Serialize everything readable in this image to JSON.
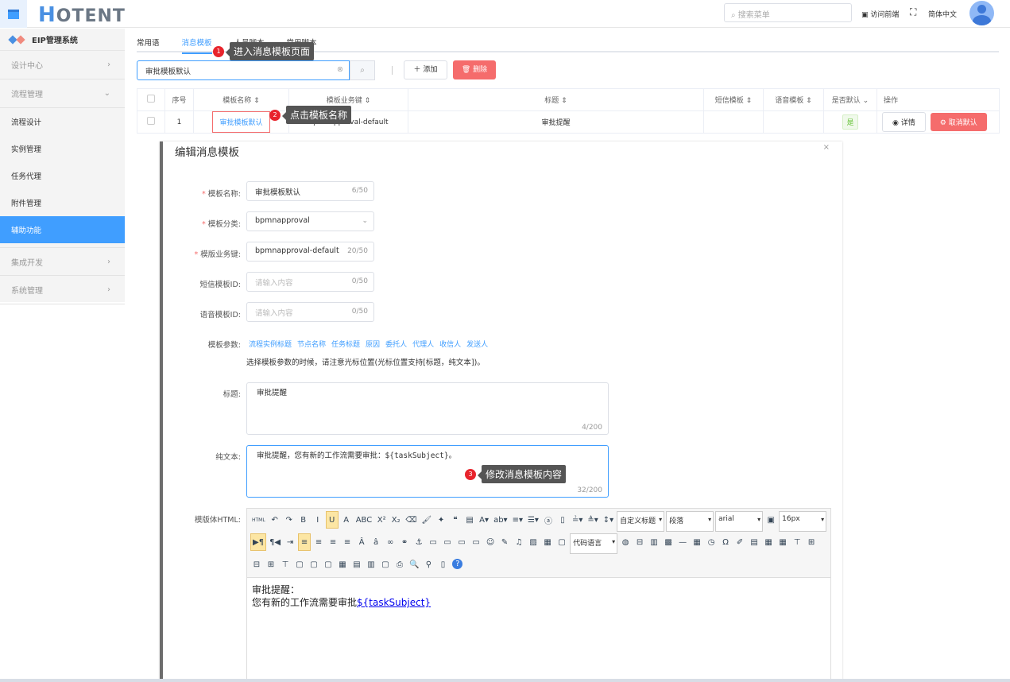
{
  "header": {
    "logo_text": "HOTENT",
    "search_placeholder": "搜索菜单",
    "visit_front": "访问前端",
    "language": "简体中文"
  },
  "sidebar": {
    "brand": "EIP管理系统",
    "groups": [
      {
        "label": "设计中心"
      },
      {
        "label": "流程管理"
      }
    ],
    "items": [
      {
        "label": "流程设计"
      },
      {
        "label": "实例管理"
      },
      {
        "label": "任务代理"
      },
      {
        "label": "附件管理"
      },
      {
        "label": "辅助功能"
      }
    ],
    "groups2": [
      {
        "label": "集成开发"
      },
      {
        "label": "系统管理"
      }
    ]
  },
  "tabs": [
    {
      "label": "常用语"
    },
    {
      "label": "消息模板"
    },
    {
      "label": "人员脚本"
    },
    {
      "label": "常用脚本"
    }
  ],
  "toolbar": {
    "search_value": "审批模板默认",
    "add_label": "添加",
    "delete_label": "删除"
  },
  "table": {
    "headers": [
      "序号",
      "模板名称",
      "模板业务键",
      "标题",
      "短信模板",
      "语音模板",
      "是否默认",
      "操作"
    ],
    "rows": [
      {
        "index": "1",
        "name": "审批模板默认",
        "key": "bpmnapproval-default",
        "title": "审批提醒",
        "sms": "",
        "voice": "",
        "default": "是",
        "detail": "详情",
        "cancel_default": "取消默认"
      }
    ]
  },
  "tips": [
    {
      "num": "1",
      "text": "进入消息模板页面"
    },
    {
      "num": "2",
      "text": "点击模板名称"
    },
    {
      "num": "3",
      "text": "修改消息模板内容"
    }
  ],
  "dialog": {
    "title": "编辑消息模板",
    "close": "×",
    "fields": [
      {
        "label": "模板名称:",
        "value": "审批模板默认",
        "count": "6/50",
        "required": true
      },
      {
        "label": "模板分类:",
        "value": "bpmnapproval",
        "required": true
      },
      {
        "label": "模版业务键:",
        "value": "bpmnapproval-default",
        "count": "20/50",
        "required": true
      },
      {
        "label": "短信模板ID:",
        "placeholder": "请输入内容",
        "count": "0/50"
      },
      {
        "label": "语音模板ID:",
        "placeholder": "请输入内容",
        "count": "0/50"
      }
    ],
    "params_label": "模板参数:",
    "params": [
      "流程实例标题",
      "节点名称",
      "任务标题",
      "原因",
      "委托人",
      "代理人",
      "收信人",
      "发送人"
    ],
    "params_hint": "选择模板参数的时候，请注意光标位置(光标位置支持[标题，纯文本])。",
    "subject_label": "标题:",
    "subject_value": "审批提醒",
    "subject_count": "4/200",
    "plain_label": "纯文本:",
    "plain_value": "审批提醒，您有新的工作流需要审批：${taskSubject}。",
    "plain_count": "32/200",
    "html_label": "模版体HTML:",
    "editor": {
      "heading_select": "自定义标题",
      "paragraph_select": "段落",
      "font_select": "arial",
      "size_select": "16px",
      "code_select": "代码语言",
      "line1": "审批提醒：",
      "line2": "您有新的工作流需要审批",
      "link": "${taskSubject}"
    }
  }
}
